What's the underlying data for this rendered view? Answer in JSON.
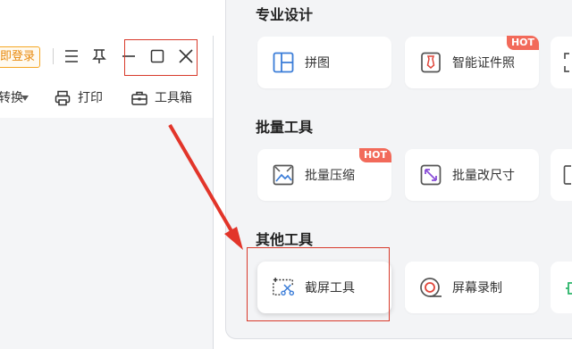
{
  "app_window": {
    "login_button": "即登录",
    "toolbar": {
      "convert_label": "转换",
      "print_label": "打印",
      "toolbox_label": "工具箱"
    }
  },
  "panel": {
    "sections": [
      {
        "title": "专业设计",
        "cards": [
          {
            "label": "拼图",
            "icon": "collage-icon"
          },
          {
            "label": "智能证件照",
            "icon": "id-photo-icon",
            "badge": "HOT"
          }
        ]
      },
      {
        "title": "批量工具",
        "cards": [
          {
            "label": "批量压缩",
            "icon": "image-compress-icon",
            "badge": "HOT"
          },
          {
            "label": "批量改尺寸",
            "icon": "resize-icon"
          }
        ]
      },
      {
        "title": "其他工具",
        "cards": [
          {
            "label": "截屏工具",
            "icon": "screenshot-scissors-icon"
          },
          {
            "label": "屏幕录制",
            "icon": "screen-record-icon"
          }
        ]
      }
    ]
  },
  "colors": {
    "highlight": "#d83a2b",
    "hot_badge": "#f26a5a",
    "login_accent": "#f5a623"
  }
}
